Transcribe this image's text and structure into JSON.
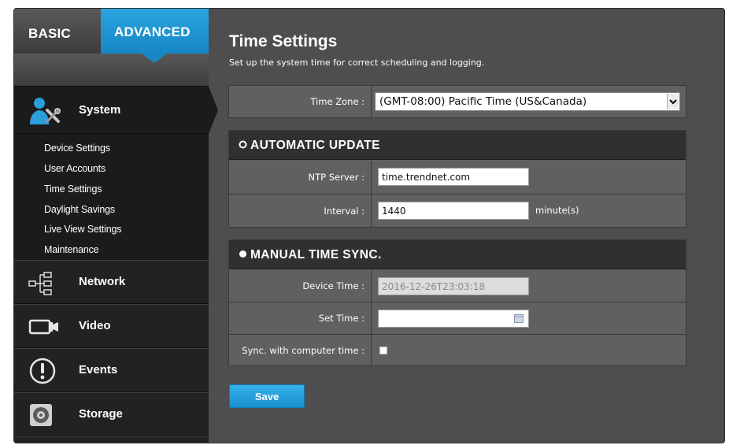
{
  "tabs": {
    "basic": "BASIC",
    "advanced": "ADVANCED"
  },
  "sidebar": {
    "system": "System",
    "submenu": [
      "Device Settings",
      "User Accounts",
      "Time Settings",
      "Daylight Savings",
      "Live View Settings",
      "Maintenance"
    ],
    "network": "Network",
    "video": "Video",
    "events": "Events",
    "storage": "Storage"
  },
  "main": {
    "title": "Time Settings",
    "subtitle": "Set up the system time for correct scheduling and logging.",
    "time_zone_label": "Time Zone :",
    "time_zone_value": "(GMT-08:00) Pacific Time (US&Canada)",
    "auto_header": "AUTOMATIC UPDATE",
    "ntp_label": "NTP Server :",
    "ntp_value": "time.trendnet.com",
    "interval_label": "Interval :",
    "interval_value": "1440",
    "interval_unit": "minute(s)",
    "manual_header": "MANUAL TIME SYNC.",
    "device_time_label": "Device Time :",
    "device_time_value": "2016-12-26T23:03:18",
    "set_time_label": "Set Time :",
    "set_time_value": "",
    "sync_label": "Sync. with computer time :",
    "save": "Save"
  },
  "colors": {
    "accent": "#1a8fcf",
    "sidebar": "#1b1b1b",
    "panel": "#606060",
    "header": "#303030"
  }
}
